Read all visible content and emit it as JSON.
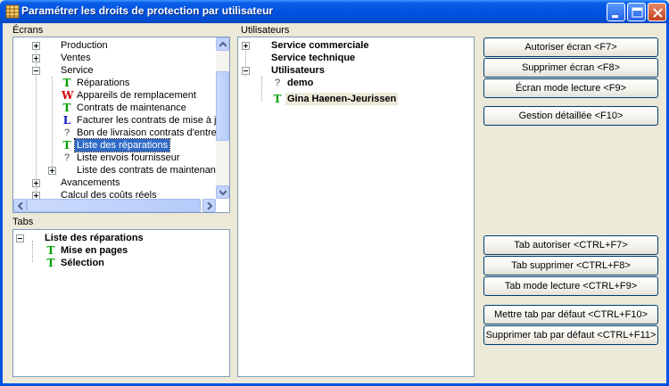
{
  "window": {
    "title": "Paramétrer les droits de protection par utilisateur"
  },
  "ecrans": {
    "label": "Écrans",
    "rows": [
      {
        "text": "Production",
        "expander": "plus"
      },
      {
        "text": "Ventes",
        "expander": "plus"
      },
      {
        "text": "Service",
        "expander": "minus"
      },
      {
        "text": "Réparations",
        "icon": "T"
      },
      {
        "text": "Appareils de remplacement",
        "icon": "W"
      },
      {
        "text": "Contrats de maintenance",
        "icon": "T"
      },
      {
        "text": "Facturer les contrats de mise à jou",
        "icon": "L"
      },
      {
        "text": "Bon de livraison contrats d'entretie",
        "icon": "?"
      },
      {
        "text": "Liste des réparations",
        "icon": "T",
        "selected": true
      },
      {
        "text": "Liste envois fournisseur",
        "icon": "?"
      },
      {
        "text": "Liste des contrats de maintenance",
        "expander": "plus"
      },
      {
        "text": "Avancements",
        "expander": "plus"
      },
      {
        "text": "Calcul des coûts réels",
        "expander": "plus"
      }
    ]
  },
  "tabs": {
    "label": "Tabs",
    "root": "Liste des réparations",
    "items": [
      {
        "text": "Mise en pages",
        "icon": "T"
      },
      {
        "text": "Sélection",
        "icon": "T"
      }
    ]
  },
  "utilisateurs": {
    "label": "Utilisateurs",
    "groups": [
      {
        "text": "Service commerciale",
        "expander": "plus"
      },
      {
        "text": "Service technique"
      },
      {
        "text": "Utilisateurs",
        "expander": "minus"
      }
    ],
    "users": [
      {
        "text": "demo",
        "icon": "?"
      },
      {
        "text": "Gina Haenen-Jeurissen",
        "icon": "T",
        "highlighted": true
      }
    ]
  },
  "buttons": {
    "autoriser_ecran": "Autoriser écran <F7>",
    "supprimer_ecran": "Supprimer écran <F8>",
    "ecran_lecture": "Écran mode lecture <F9>",
    "gestion_detaillee": "Gestion détaillée <F10>",
    "tab_autoriser": "Tab autoriser <CTRL+F7>",
    "tab_supprimer": "Tab supprimer <CTRL+F8>",
    "tab_lecture": "Tab mode lecture <CTRL+F9>",
    "tab_defaut": "Mettre tab par défaut <CTRL+F10>",
    "supprimer_tab_defaut": "Supprimer tab par défaut <CTRL+F11>"
  },
  "icons": {
    "app": "grid-app-icon",
    "minimize": "minimize-icon",
    "maximize": "maximize-icon",
    "close": "close-icon"
  }
}
